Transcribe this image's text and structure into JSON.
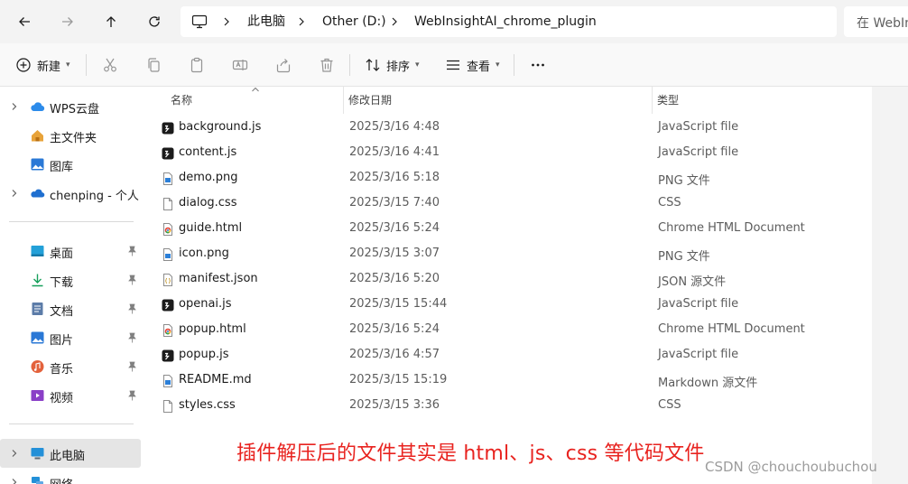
{
  "breadcrumb": [
    "此电脑",
    "Other (D:)",
    "WebInsightAI_chrome_plugin"
  ],
  "search": {
    "placeholder": "在 WebIn"
  },
  "toolbar": {
    "new_label": "新建",
    "sort_label": "排序",
    "view_label": "查看"
  },
  "sidebar": {
    "top": [
      {
        "label": "WPS云盘",
        "icon": "cloud-icon",
        "expandable": true
      },
      {
        "label": "主文件夹",
        "icon": "home-icon",
        "expandable": false
      },
      {
        "label": "图库",
        "icon": "gallery-icon",
        "expandable": false
      },
      {
        "label": "chenping - 个人",
        "icon": "onedrive-icon",
        "expandable": true
      }
    ],
    "quick": [
      {
        "label": "桌面",
        "icon": "desktop-icon"
      },
      {
        "label": "下载",
        "icon": "download-icon"
      },
      {
        "label": "文档",
        "icon": "documents-icon"
      },
      {
        "label": "图片",
        "icon": "pictures-icon"
      },
      {
        "label": "音乐",
        "icon": "music-icon"
      },
      {
        "label": "视频",
        "icon": "videos-icon"
      }
    ],
    "bottom": [
      {
        "label": "此电脑",
        "icon": "this-pc-icon"
      },
      {
        "label": "网络",
        "icon": "network-icon"
      }
    ]
  },
  "columns": {
    "name": "名称",
    "date": "修改日期",
    "type": "类型"
  },
  "files": [
    {
      "name": "background.js",
      "date": "2025/3/16 4:48",
      "type": "JavaScript file",
      "icon": "js"
    },
    {
      "name": "content.js",
      "date": "2025/3/16 4:41",
      "type": "JavaScript file",
      "icon": "js"
    },
    {
      "name": "demo.png",
      "date": "2025/3/16 5:18",
      "type": "PNG 文件",
      "icon": "png"
    },
    {
      "name": "dialog.css",
      "date": "2025/3/15 7:40",
      "type": "CSS",
      "icon": "doc"
    },
    {
      "name": "guide.html",
      "date": "2025/3/16 5:24",
      "type": "Chrome HTML Document",
      "icon": "chrome"
    },
    {
      "name": "icon.png",
      "date": "2025/3/15 3:07",
      "type": "PNG 文件",
      "icon": "png"
    },
    {
      "name": "manifest.json",
      "date": "2025/3/16 5:20",
      "type": "JSON 源文件",
      "icon": "json"
    },
    {
      "name": "openai.js",
      "date": "2025/3/15 15:44",
      "type": "JavaScript file",
      "icon": "js"
    },
    {
      "name": "popup.html",
      "date": "2025/3/16 5:24",
      "type": "Chrome HTML Document",
      "icon": "chrome"
    },
    {
      "name": "popup.js",
      "date": "2025/3/16 4:57",
      "type": "JavaScript file",
      "icon": "js"
    },
    {
      "name": "README.md",
      "date": "2025/3/15 15:19",
      "type": "Markdown 源文件",
      "icon": "md"
    },
    {
      "name": "styles.css",
      "date": "2025/3/15 3:36",
      "type": "CSS",
      "icon": "doc"
    }
  ],
  "annotation": "插件解压后的文件其实是 html、js、css 等代码文件",
  "watermark": "CSDN @chouchoubuchou",
  "colors": {
    "annotation": "#e8231f",
    "selected": "#e5e5e5",
    "accent": "#1f6fd0"
  }
}
